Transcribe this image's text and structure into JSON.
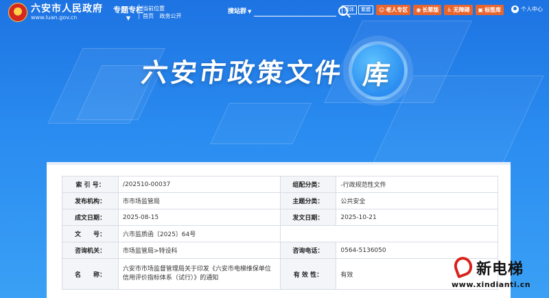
{
  "header": {
    "site_title": "六安市人民政府",
    "site_url": "www.luan.gov.cn",
    "topic_label": "专题专栏",
    "location_label": "当前位置",
    "breadcrumb": [
      "首页",
      "政务公开"
    ],
    "search_scope": "搜站群",
    "search_placeholder": "",
    "lang_buttons": [
      "简体",
      "繁體"
    ],
    "tools": [
      {
        "label": "老人专区",
        "icon": "elder-icon"
      },
      {
        "label": "长辈版",
        "icon": "elder-mode-icon"
      },
      {
        "label": "无障碍",
        "icon": "accessibility-icon"
      },
      {
        "label": "标签库",
        "icon": "tag-icon"
      }
    ],
    "user_label": "个人中心"
  },
  "banner": {
    "title": "六安市政策文件",
    "title_suffix": "库"
  },
  "document_info": {
    "rows": [
      [
        {
          "label": "索 引 号：",
          "value": "/202510-00037"
        },
        {
          "label": "组配分类：",
          "value": "-行政规范性文件"
        }
      ],
      [
        {
          "label": "发布机构：",
          "value": "市市场监管局"
        },
        {
          "label": "主题分类：",
          "value": "公共安全"
        }
      ],
      [
        {
          "label": "成文日期：",
          "value": "2025-08-15"
        },
        {
          "label": "发文日期：",
          "value": "2025-10-21"
        }
      ],
      [
        {
          "label": "文　　号：",
          "value": "六市监质函〔2025〕64号"
        },
        {
          "label": "",
          "value": ""
        }
      ],
      [
        {
          "label": "咨询机关：",
          "value": "市场监管局>特设科"
        },
        {
          "label": "咨询电话：",
          "value": "0564-5136050"
        }
      ],
      [
        {
          "label": "名　　称：",
          "value": "六安市市场监督管理局关于印发《六安市电梯维保单位信用评价指标体系（试行）》的通知"
        },
        {
          "label": "有 效 性：",
          "value": "有效"
        }
      ]
    ]
  },
  "watermark": {
    "title": "新电梯",
    "url": "www.xindianti.cn"
  },
  "colors": {
    "header_bg": "#1d73e2",
    "tool_button": "#e8652f",
    "label_cell_bg": "#f3f5f8",
    "watermark_red": "#d8221a"
  }
}
